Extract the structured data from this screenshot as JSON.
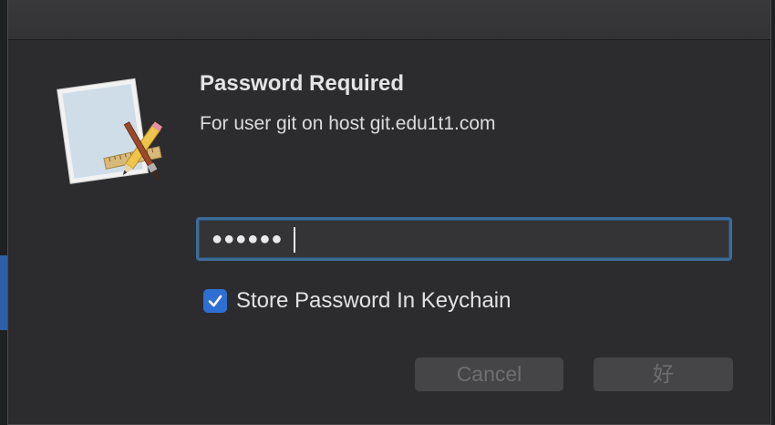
{
  "dialog": {
    "title": "Password Required",
    "subtitle": "For user git on host git.edu1t1.com",
    "app_icon": "script-editor-icon"
  },
  "password_field": {
    "value_masked": "●●●●●●",
    "focused": true
  },
  "keychain_checkbox": {
    "label": "Store Password In Keychain",
    "checked": true
  },
  "buttons": {
    "cancel_label": "Cancel",
    "ok_label": "好"
  },
  "colors": {
    "dialog_bg": "#2c2c2e",
    "focus_ring": "#3d6c98",
    "checkbox_accent": "#2f6fd4",
    "button_bg": "#454547",
    "button_text_disabled": "#6e6e70"
  }
}
